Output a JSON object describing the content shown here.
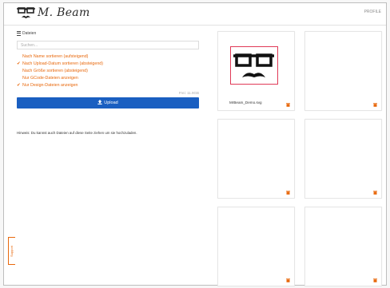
{
  "header": {
    "logo_text": "M. Beam",
    "top_right": "PROFILE"
  },
  "files": {
    "title": "Dateien",
    "search_placeholder": "Suchen...",
    "options": [
      {
        "label": "Nach Name sortieren (aufsteigend)",
        "checked": false
      },
      {
        "label": "Nach Upload-Datum sortieren (absteigend)",
        "checked": true
      },
      {
        "label": "Nach Größe sortieren (absteigend)",
        "checked": false
      },
      {
        "label": "Nur GCode-Dateien anzeigen",
        "checked": false
      },
      {
        "label": "Nur Design-Dateien anzeigen",
        "checked": true
      }
    ],
    "free_space": "Frei: 11.9GB",
    "upload_label": "Upload",
    "hint": "Hinweis: Du kannst auch Dateien auf diese Seite ziehen um sie hochzuladen."
  },
  "support_label": "Support",
  "gallery": {
    "cards": [
      {
        "name": "MrBeam_Demo.svg",
        "has_thumb": true
      },
      {
        "name": "",
        "has_thumb": false
      },
      {
        "name": "",
        "has_thumb": false
      },
      {
        "name": "",
        "has_thumb": false
      },
      {
        "name": "",
        "has_thumb": false
      },
      {
        "name": "",
        "has_thumb": false
      }
    ]
  },
  "colors": {
    "accent": "#e8680c",
    "upload_button": "#1a5fc1",
    "thumb_border": "#e03a57"
  }
}
